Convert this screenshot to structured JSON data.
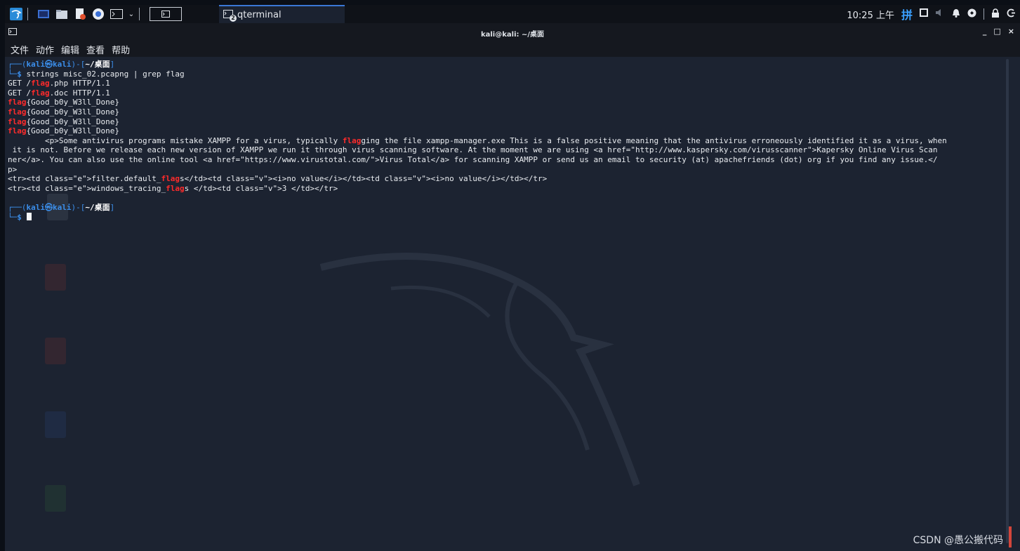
{
  "taskbar": {
    "task_title": "qterminal",
    "task_badge": "2",
    "clock": "10:25 上午",
    "ime_label": "拼"
  },
  "window": {
    "title": "kali@kali: ~/桌面",
    "minimize": "_",
    "maximize": "□",
    "close": "×"
  },
  "menu": {
    "items": [
      "文件",
      "动作",
      "编辑",
      "查看",
      "帮助"
    ]
  },
  "terminal": {
    "prompt_user": "kali",
    "prompt_at": "㉿",
    "prompt_host": "kali",
    "prompt_dir": "~/桌面",
    "command": "strings misc_02.pcapng | grep flag",
    "output": [
      {
        "pre": "GET /",
        "hl": "flag",
        "post": ".php HTTP/1.1"
      },
      {
        "pre": "GET /",
        "hl": "flag",
        "post": ".doc HTTP/1.1"
      },
      {
        "pre": "",
        "hl": "flag",
        "post": "{Good_b0y_W3ll_Done}"
      },
      {
        "pre": "",
        "hl": "flag",
        "post": "{Good_b0y_W3ll_Done}"
      },
      {
        "pre": "",
        "hl": "flag",
        "post": "{Good_b0y_W3ll_Done}"
      },
      {
        "pre": "",
        "hl": "flag",
        "post": "{Good_b0y_W3ll_Done}"
      },
      {
        "pre": "        <p>Some antivirus programs mistake XAMPP for a virus, typically ",
        "hl": "flag",
        "post": "ging the file xampp-manager.exe This is a false positive meaning that the antivirus erroneously identified it as a virus, when"
      },
      {
        "pre": " it is not. Before we release each new version of XAMPP we run it through virus scanning software. At the moment we are using <a href=\"http://www.kaspersky.com/virusscanner\">Kapersky Online Virus Scan",
        "hl": "",
        "post": ""
      },
      {
        "pre": "ner</a>. You can also use the online tool <a href=\"https://www.virustotal.com/\">Virus Total</a> for scanning XAMPP or send us an email to security (at) apachefriends (dot) org if you find any issue.</",
        "hl": "",
        "post": ""
      },
      {
        "pre": "p>",
        "hl": "",
        "post": ""
      },
      {
        "pre": "<tr><td class=\"e\">filter.default_",
        "hl": "flag",
        "post": "s</td><td class=\"v\"><i>no value</i></td><td class=\"v\"><i>no value</i></td></tr>"
      },
      {
        "pre": "<tr><td class=\"e\">windows_tracing_",
        "hl": "flag",
        "post": "s </td><td class=\"v\">3 </td></tr>"
      }
    ]
  },
  "watermark": "CSDN @愚公搬代码",
  "colors": {
    "highlight": "#ff2b2b",
    "prompt": "#3b8eea",
    "terminal_bg": "#1c2331",
    "taskbar_bg": "#0f1218"
  }
}
